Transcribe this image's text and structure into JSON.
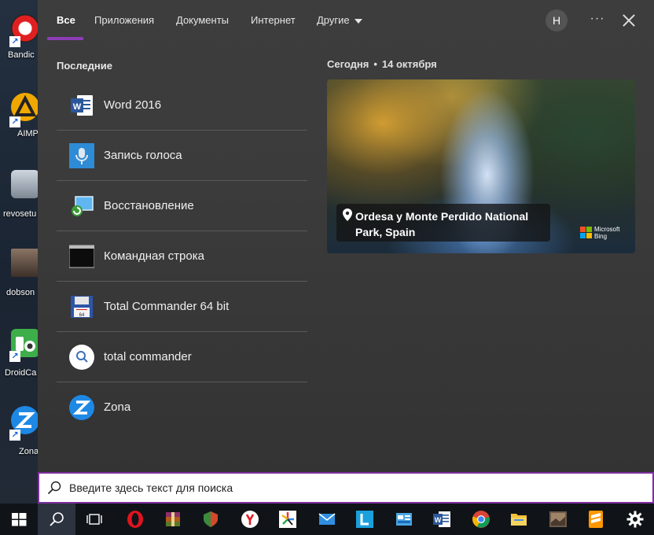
{
  "desktop": {
    "icons": [
      {
        "label": "Bandic",
        "icon": "bandicam-icon",
        "color": "#e02020"
      },
      {
        "label": "AIMP",
        "icon": "aimp-icon",
        "color": "#f0a800"
      },
      {
        "label": "revosetu",
        "icon": "revo-uninstaller-icon",
        "color": "#9aa6b4"
      },
      {
        "label": "dobson",
        "icon": "shortcut-image-icon",
        "color": "#6a5848"
      },
      {
        "label": "DroidCa",
        "icon": "droidcam-icon",
        "color": "#3dae4a"
      },
      {
        "label": "Zona",
        "icon": "zona-icon",
        "color": "#1e88e5"
      }
    ]
  },
  "search_panel": {
    "tabs": [
      {
        "label": "Все",
        "active": true
      },
      {
        "label": "Приложения"
      },
      {
        "label": "Документы"
      },
      {
        "label": "Интернет"
      },
      {
        "label": "Другие",
        "dropdown": true
      }
    ],
    "avatar_letter": "Н",
    "more_glyph": "···",
    "recent": {
      "title": "Последние",
      "items": [
        {
          "label": "Word 2016",
          "icon": "word-icon"
        },
        {
          "label": "Запись голоса",
          "icon": "voice-recorder-icon"
        },
        {
          "label": "Восстановление",
          "icon": "recovery-icon"
        },
        {
          "label": "Командная строка",
          "icon": "command-prompt-icon"
        },
        {
          "label": "Total Commander 64 bit",
          "icon": "total-commander-icon"
        },
        {
          "label": "total commander",
          "icon": "web-search-icon"
        },
        {
          "label": "Zona",
          "icon": "zona-icon"
        }
      ]
    },
    "today": {
      "label": "Сегодня",
      "separator": "•",
      "date": "14 октября",
      "card": {
        "caption": "Ordesa y Monte Perdido National Park, Spain",
        "brand_line1": "Microsoft",
        "brand_line2": "Bing"
      }
    }
  },
  "searchbox": {
    "placeholder": "Введите здесь текст для поиска"
  },
  "taskbar": {
    "items": [
      {
        "name": "start-button",
        "icon": "windows-logo-icon"
      },
      {
        "name": "search-button",
        "icon": "search-icon",
        "active": true
      },
      {
        "name": "task-view-button",
        "icon": "task-view-icon"
      },
      {
        "name": "opera-button",
        "icon": "opera-icon"
      },
      {
        "name": "winrar-button",
        "icon": "winrar-icon"
      },
      {
        "name": "app-shield-button",
        "icon": "shield-app-icon"
      },
      {
        "name": "yandex-browser-button",
        "icon": "yandex-browser-icon"
      },
      {
        "name": "photo-app-button",
        "icon": "pinwheel-app-icon"
      },
      {
        "name": "mail-button",
        "icon": "mail-icon"
      },
      {
        "name": "lingvo-button",
        "icon": "letter-l-icon"
      },
      {
        "name": "control-panel-button",
        "icon": "control-panel-icon"
      },
      {
        "name": "word-button",
        "icon": "word-icon"
      },
      {
        "name": "chrome-button",
        "icon": "chrome-icon"
      },
      {
        "name": "explorer-button",
        "icon": "folder-icon"
      },
      {
        "name": "image-viewer-button",
        "icon": "image-viewer-icon"
      },
      {
        "name": "sublime-button",
        "icon": "sublime-text-icon"
      },
      {
        "name": "settings-button",
        "icon": "gear-icon"
      }
    ]
  }
}
